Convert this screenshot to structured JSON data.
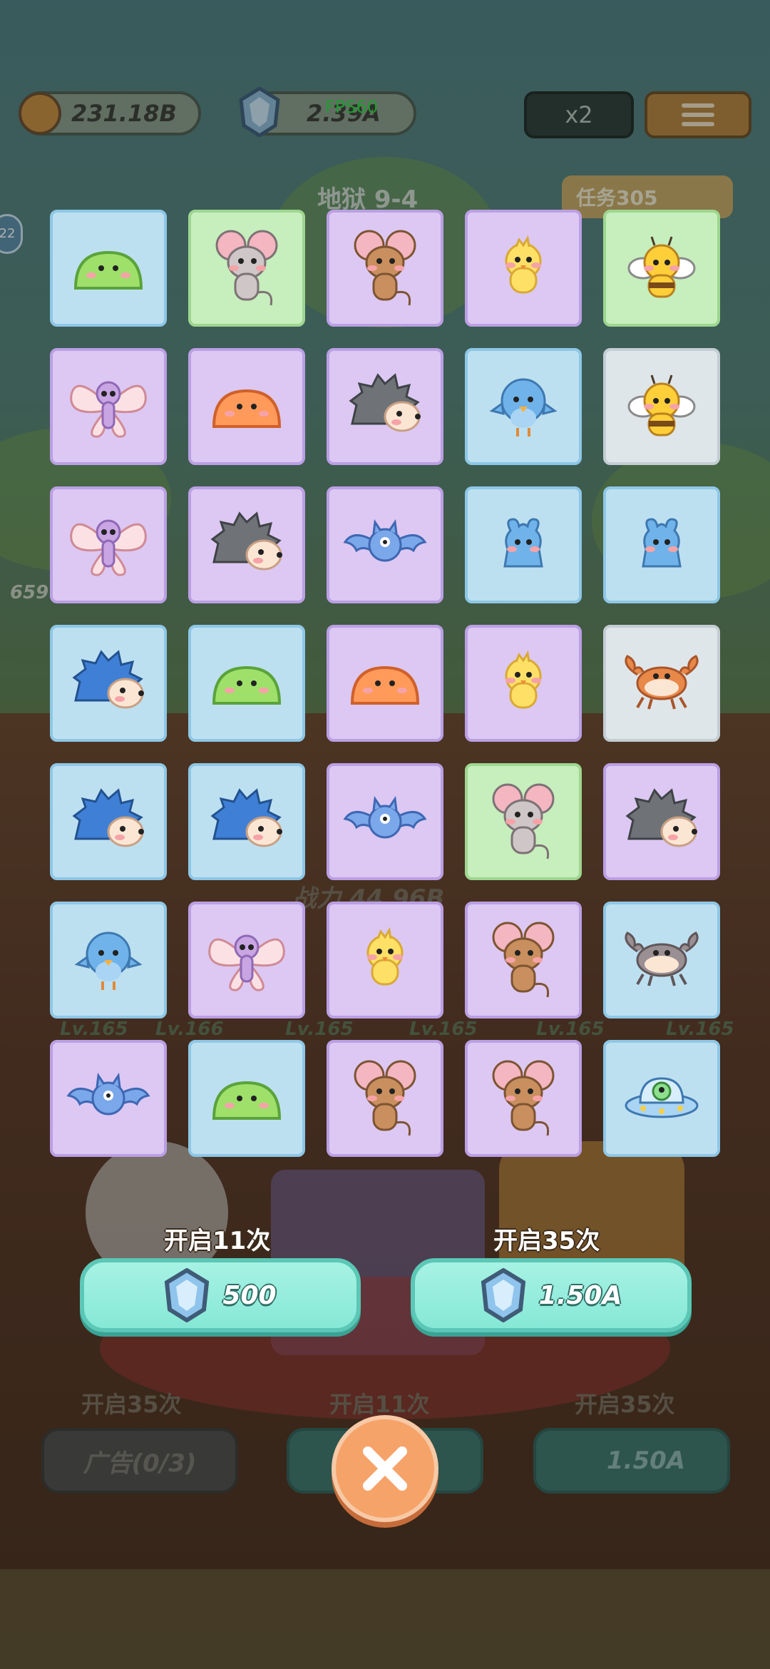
{
  "hud": {
    "coins": "231.18B",
    "gems": "2.39A",
    "fps": "FPS60",
    "speed": "x2",
    "stage": "地狱 9-4",
    "task": "任务305",
    "side_badge": "22"
  },
  "background": {
    "power_label": "战力 44.96B",
    "levels": [
      "Lv.165",
      "Lv.166",
      "Lv.165",
      "Lv.165",
      "Lv.165",
      "Lv.165"
    ],
    "bottom_labels": [
      "开启35次",
      "开启11次",
      "开启35次"
    ],
    "ad_button": "广告(0/3)",
    "bg_cost": "1.50A",
    "left_number": "659"
  },
  "reward_grid": [
    {
      "creature": "slime-green",
      "bg": "blue"
    },
    {
      "creature": "mouse-gray",
      "bg": "green"
    },
    {
      "creature": "mouse-brown",
      "bg": "purple"
    },
    {
      "creature": "chick",
      "bg": "purple"
    },
    {
      "creature": "bee",
      "bg": "green"
    },
    {
      "creature": "butterfly",
      "bg": "purple"
    },
    {
      "creature": "slime-orange",
      "bg": "purple"
    },
    {
      "creature": "hedgehog-gray",
      "bg": "purple"
    },
    {
      "creature": "bird-blue",
      "bg": "blue"
    },
    {
      "creature": "bee",
      "bg": "gray"
    },
    {
      "creature": "butterfly",
      "bg": "purple"
    },
    {
      "creature": "hedgehog-gray",
      "bg": "purple"
    },
    {
      "creature": "bat",
      "bg": "purple"
    },
    {
      "creature": "blob-blue",
      "bg": "blue"
    },
    {
      "creature": "blob-blue",
      "bg": "blue"
    },
    {
      "creature": "hedgehog-blue",
      "bg": "blue"
    },
    {
      "creature": "slime-green",
      "bg": "blue"
    },
    {
      "creature": "slime-orange",
      "bg": "purple"
    },
    {
      "creature": "chick",
      "bg": "purple"
    },
    {
      "creature": "crab-orange",
      "bg": "gray"
    },
    {
      "creature": "hedgehog-blue",
      "bg": "blue"
    },
    {
      "creature": "hedgehog-blue",
      "bg": "blue"
    },
    {
      "creature": "bat",
      "bg": "purple"
    },
    {
      "creature": "mouse-gray",
      "bg": "green"
    },
    {
      "creature": "hedgehog-gray",
      "bg": "purple"
    },
    {
      "creature": "bird-blue",
      "bg": "blue"
    },
    {
      "creature": "butterfly",
      "bg": "purple"
    },
    {
      "creature": "chick",
      "bg": "purple"
    },
    {
      "creature": "mouse-brown",
      "bg": "purple"
    },
    {
      "creature": "crab-gray",
      "bg": "blue"
    },
    {
      "creature": "bat",
      "bg": "purple"
    },
    {
      "creature": "slime-green",
      "bg": "blue"
    },
    {
      "creature": "mouse-brown",
      "bg": "purple"
    },
    {
      "creature": "mouse-brown",
      "bg": "purple"
    },
    {
      "creature": "ufo",
      "bg": "blue"
    }
  ],
  "open_options": [
    {
      "label": "开启11次",
      "cost": "500",
      "icon": "gem-icon"
    },
    {
      "label": "开启35次",
      "cost": "1.50A",
      "icon": "gem-icon"
    }
  ],
  "close_icon": "close-icon"
}
